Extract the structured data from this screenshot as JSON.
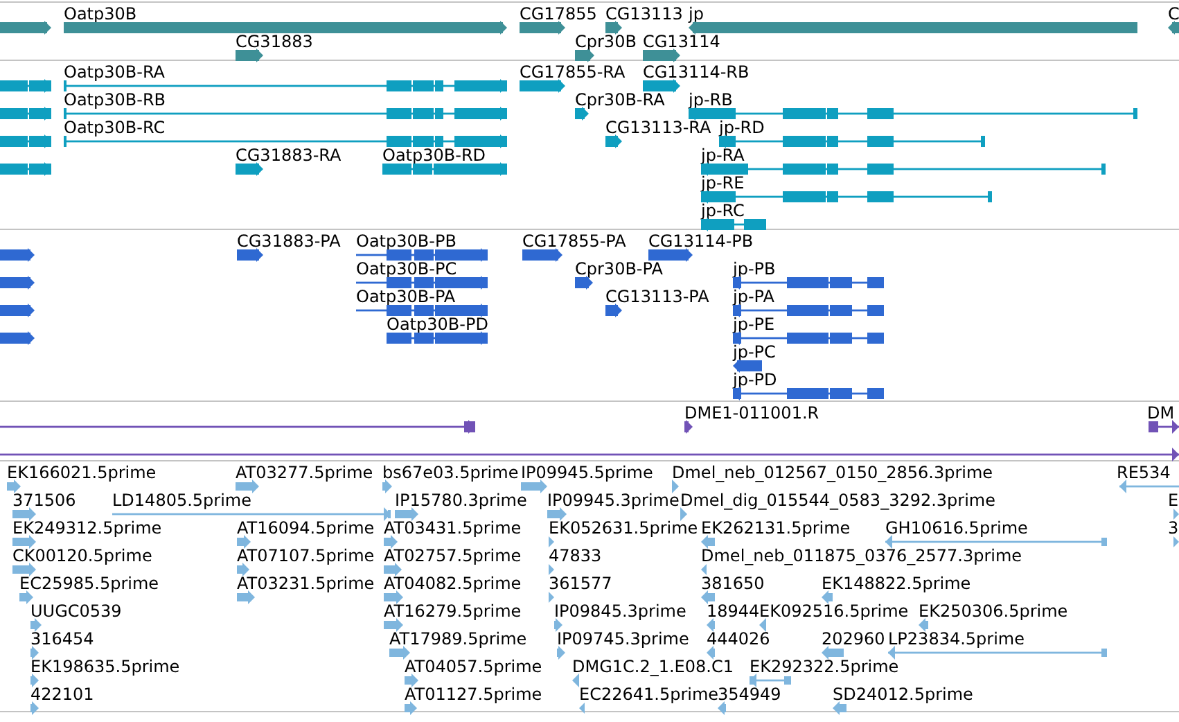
{
  "tracks": [
    {
      "kind": "gene",
      "features": [
        {
          "reverse": false
        },
        {
          "label": "Oatp30B",
          "reverse": false
        },
        {
          "label": "CG31883",
          "reverse": false
        },
        {
          "label": "CG17855",
          "reverse": false
        },
        {
          "label": "Cpr30B",
          "reverse": false
        },
        {
          "label": "CG13113",
          "reverse": false
        },
        {
          "label": "CG13114",
          "reverse": false
        },
        {
          "label": "jp",
          "reverse": true
        },
        {
          "label": "C",
          "reverse": true
        }
      ]
    },
    {
      "kind": "transcript",
      "features": [
        {
          "reverse": false
        },
        {
          "reverse": false
        },
        {
          "reverse": false
        },
        {
          "reverse": false
        },
        {
          "label": "Oatp30B-RA",
          "reverse": false
        },
        {
          "label": "Oatp30B-RB",
          "reverse": false
        },
        {
          "label": "Oatp30B-RC",
          "reverse": false
        },
        {
          "label": "CG31883-RA",
          "reverse": false
        },
        {
          "label": "Oatp30B-RD",
          "reverse": false
        },
        {
          "label": "CG17855-RA",
          "reverse": false
        },
        {
          "label": "CG13114-RB",
          "reverse": false
        },
        {
          "label": "Cpr30B-RA",
          "reverse": false
        },
        {
          "label": "jp-RB",
          "reverse": true
        },
        {
          "label": "CG13113-RA",
          "reverse": false
        },
        {
          "label": "jp-RD",
          "reverse": true
        },
        {
          "label": "jp-RA",
          "reverse": true
        },
        {
          "label": "jp-RE",
          "reverse": true
        },
        {
          "label": "jp-RC",
          "reverse": true
        }
      ]
    },
    {
      "kind": "protein",
      "features": [
        {
          "reverse": false
        },
        {
          "reverse": false
        },
        {
          "reverse": false
        },
        {
          "reverse": false
        },
        {
          "label": "CG31883-PA",
          "reverse": false
        },
        {
          "label": "Oatp30B-PB",
          "reverse": false
        },
        {
          "label": "Oatp30B-PC",
          "reverse": false
        },
        {
          "label": "Oatp30B-PA",
          "reverse": false
        },
        {
          "label": "Oatp30B-PD",
          "reverse": false
        },
        {
          "label": "CG17855-PA",
          "reverse": false
        },
        {
          "label": "CG13114-PB",
          "reverse": false
        },
        {
          "label": "Cpr30B-PA",
          "reverse": false
        },
        {
          "label": "jp-PB",
          "reverse": true
        },
        {
          "label": "CG13113-PA",
          "reverse": false
        },
        {
          "label": "jp-PA",
          "reverse": true
        },
        {
          "label": "jp-PE",
          "reverse": true
        },
        {
          "label": "jp-PC",
          "reverse": true
        },
        {
          "label": "jp-PD",
          "reverse": true
        }
      ]
    },
    {
      "kind": "match",
      "features": [
        {
          "reverse": false
        },
        {
          "label": "DME1-011001.R",
          "reverse": false
        },
        {
          "label": "DM",
          "reverse": false
        },
        {
          "reverse": false
        }
      ]
    },
    {
      "kind": "est",
      "features": [
        {
          "label": "EK166021.5prime",
          "reverse": false
        },
        {
          "label": "AT03277.5prime",
          "reverse": false
        },
        {
          "label": "bs67e03.5prime",
          "reverse": false
        },
        {
          "label": "IP09945.5prime",
          "reverse": false
        },
        {
          "label": "Dmel_neb_012567_0150_2856.3prime",
          "reverse": false
        },
        {
          "label": "RE534",
          "reverse": true
        },
        {
          "label": "371506",
          "reverse": false
        },
        {
          "label": "LD14805.5prime",
          "reverse": false
        },
        {
          "label": "IP15780.3prime",
          "reverse": false
        },
        {
          "label": "IP09945.3prime",
          "reverse": false
        },
        {
          "label": "Dmel_dig_015544_0583_3292.3prime",
          "reverse": false
        },
        {
          "label": "E",
          "reverse": false
        },
        {
          "label": "EK249312.5prime",
          "reverse": false
        },
        {
          "label": "AT16094.5prime",
          "reverse": false
        },
        {
          "label": "AT03431.5prime",
          "reverse": false
        },
        {
          "label": "EK052631.5prime",
          "reverse": false
        },
        {
          "label": "EK262131.5prime",
          "reverse": true
        },
        {
          "label": "GH10616.5prime",
          "reverse": true
        },
        {
          "label": "3",
          "reverse": false
        },
        {
          "label": "CK00120.5prime",
          "reverse": false
        },
        {
          "label": "AT07107.5prime",
          "reverse": false
        },
        {
          "label": "AT02757.5prime",
          "reverse": false
        },
        {
          "label": "47833",
          "reverse": false
        },
        {
          "label": "Dmel_neb_011875_0376_2577.3prime",
          "reverse": true
        },
        {
          "label": "EC25985.5prime",
          "reverse": false
        },
        {
          "label": "AT03231.5prime",
          "reverse": false
        },
        {
          "label": "AT04082.5prime",
          "reverse": false
        },
        {
          "label": "361577",
          "reverse": false
        },
        {
          "label": "381650",
          "reverse": true
        },
        {
          "label": "EK148822.5prime",
          "reverse": true
        },
        {
          "label": "UUGC0539",
          "reverse": false
        },
        {
          "label": "AT16279.5prime",
          "reverse": false
        },
        {
          "label": "IP09845.3prime",
          "reverse": false
        },
        {
          "label": "18944",
          "reverse": true
        },
        {
          "label": "EK092516.5prime",
          "reverse": true
        },
        {
          "label": "EK250306.5prime",
          "reverse": true
        },
        {
          "label": "316454",
          "reverse": false
        },
        {
          "label": "AT17989.5prime",
          "reverse": false
        },
        {
          "label": "IP09745.3prime",
          "reverse": false
        },
        {
          "label": "444026",
          "reverse": true
        },
        {
          "label": "202960",
          "reverse": true
        },
        {
          "label": "LP23834.5prime",
          "reverse": true
        },
        {
          "label": "EK198635.5prime",
          "reverse": false
        },
        {
          "label": "AT04057.5prime",
          "reverse": false
        },
        {
          "label": "DMG1C.2_1.E08.C1",
          "reverse": true
        },
        {
          "label": "EK292322.5prime",
          "reverse": true
        },
        {
          "label": "422101",
          "reverse": false
        },
        {
          "label": "AT01127.5prime",
          "reverse": false
        },
        {
          "label": "EC22641.5prime",
          "reverse": true
        },
        {
          "label": "354949",
          "reverse": true
        },
        {
          "label": "SD24012.5prime",
          "reverse": true
        }
      ]
    }
  ]
}
